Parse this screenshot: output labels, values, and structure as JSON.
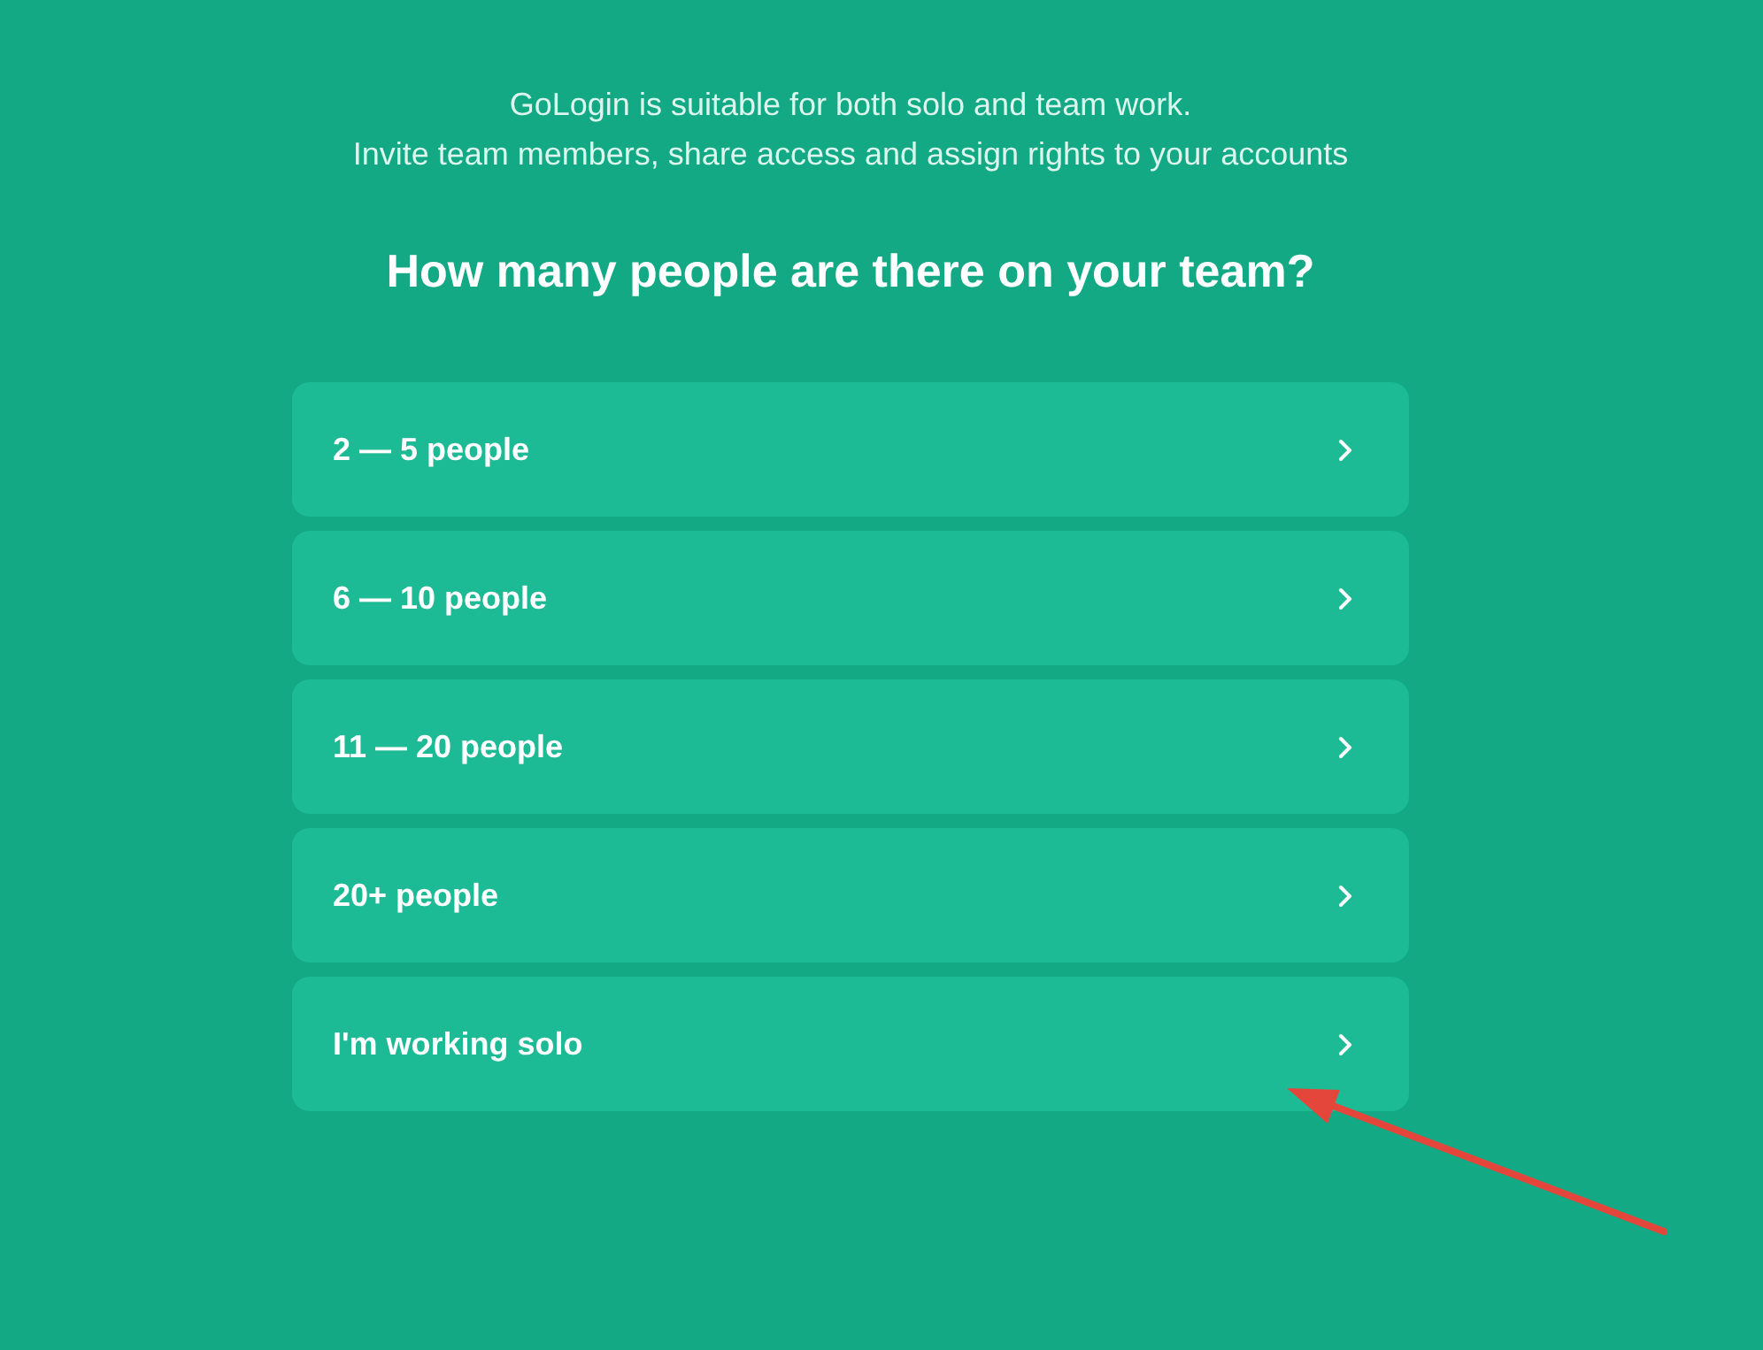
{
  "intro": {
    "lines": [
      "GoLogin is suitable for both solo and team work.",
      "Invite team members, share access and assign rights to your accounts"
    ]
  },
  "question": "How many people are there on your team?",
  "options": [
    {
      "label": "2 — 5 people"
    },
    {
      "label": "6 — 10 people"
    },
    {
      "label": "11 — 20 people"
    },
    {
      "label": "20+ people"
    },
    {
      "label": "I'm working solo"
    }
  ]
}
